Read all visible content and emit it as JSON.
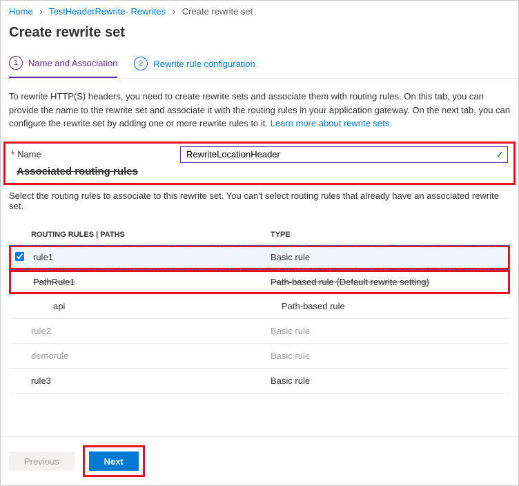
{
  "breadcrumb": {
    "items": [
      "Home",
      "TestHeaderRewrite- Rewrites",
      "Create rewrite set"
    ]
  },
  "pageTitle": "Create rewrite set",
  "tabs": [
    {
      "num": "1",
      "label": "Name and Association"
    },
    {
      "num": "2",
      "label": "Rewrite rule configuration"
    }
  ],
  "description": "To rewrite HTTP(S) headers, you need to create rewrite sets and associate them with routing rules. On this tab, you can provide the name to the rewrite set and associate it with the routing rules in your application gateway. On the next tab, you can configure the rewrite set by adding one or more rewrite rules to it.  ",
  "learnMore": "Learn more about rewrite sets.",
  "nameLabel": "Name",
  "nameValue": "RewriteLocationHeader",
  "sectionTitle": "Associated routing rules",
  "subDescription": "Select the routing rules to associate to this rewrite set. You can't select routing rules that already have an associated rewrite set.",
  "columns": {
    "name": "ROUTING RULES | PATHS",
    "type": "TYPE"
  },
  "rows": [
    {
      "name": "rule1",
      "type": "Basic rule",
      "checked": true,
      "selected": true,
      "disabled": false,
      "indent": false,
      "strike": false
    },
    {
      "name": "PathRule1",
      "type": "Path-based rule (Default rewrite setting)",
      "checked": false,
      "selected": false,
      "disabled": false,
      "indent": false,
      "strike": true
    },
    {
      "name": "api",
      "type": "Path-based rule",
      "checked": false,
      "selected": false,
      "disabled": false,
      "indent": true,
      "strike": false
    },
    {
      "name": "rule2",
      "type": "Basic rule",
      "checked": false,
      "selected": false,
      "disabled": true,
      "indent": false,
      "strike": false
    },
    {
      "name": "demorule",
      "type": "Basic rule",
      "checked": false,
      "selected": false,
      "disabled": true,
      "indent": false,
      "strike": false
    },
    {
      "name": "rule3",
      "type": "Basic rule",
      "checked": false,
      "selected": false,
      "disabled": false,
      "indent": false,
      "strike": false
    }
  ],
  "buttons": {
    "prev": "Previous",
    "next": "Next"
  }
}
